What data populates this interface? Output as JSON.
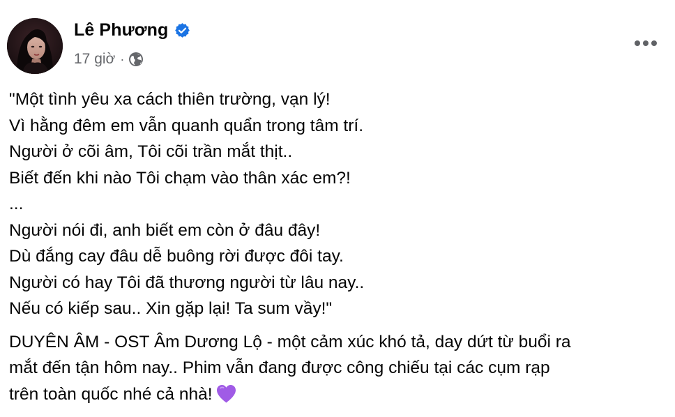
{
  "post": {
    "author_name": "Lê Phương",
    "verified_icon": "verified-badge-icon",
    "time": "17 giờ",
    "separator": "·",
    "privacy_icon": "globe-icon",
    "more_icon": "more-horizontal-icon",
    "lyrics": [
      "\"Một tình yêu xa cách thiên trường, vạn lý!",
      "Vì hằng đêm em vẫn quanh quẩn trong tâm trí.",
      "Người ở cõi âm, Tôi cõi trần mắt thịt..",
      "Biết đến khi nào Tôi chạm vào thân xác em?!",
      "...",
      "Người nói đi, anh biết em còn ở đâu đây!",
      "Dù đắng cay đâu dễ buông rời được đôi tay.",
      "Người có hay Tôi đã thương người từ lâu nay..",
      "Nếu có kiếp sau.. Xin gặp lại! Ta sum vầy!\""
    ],
    "description": [
      "DUYÊN ÂM - OST Âm Dương Lộ - một cảm xúc khó tả, day dứt từ buổi ra",
      "mắt đến tận hôm nay.. Phim vẫn đang được công chiếu tại các cụm rạp",
      "trên toàn quốc nhé cả nhà!"
    ],
    "emoji_icon": "purple-heart-icon",
    "colors": {
      "text": "#050505",
      "secondary": "#65676b",
      "verified_blue": "#1b74e4",
      "heart_purple": "#a05be6"
    }
  }
}
